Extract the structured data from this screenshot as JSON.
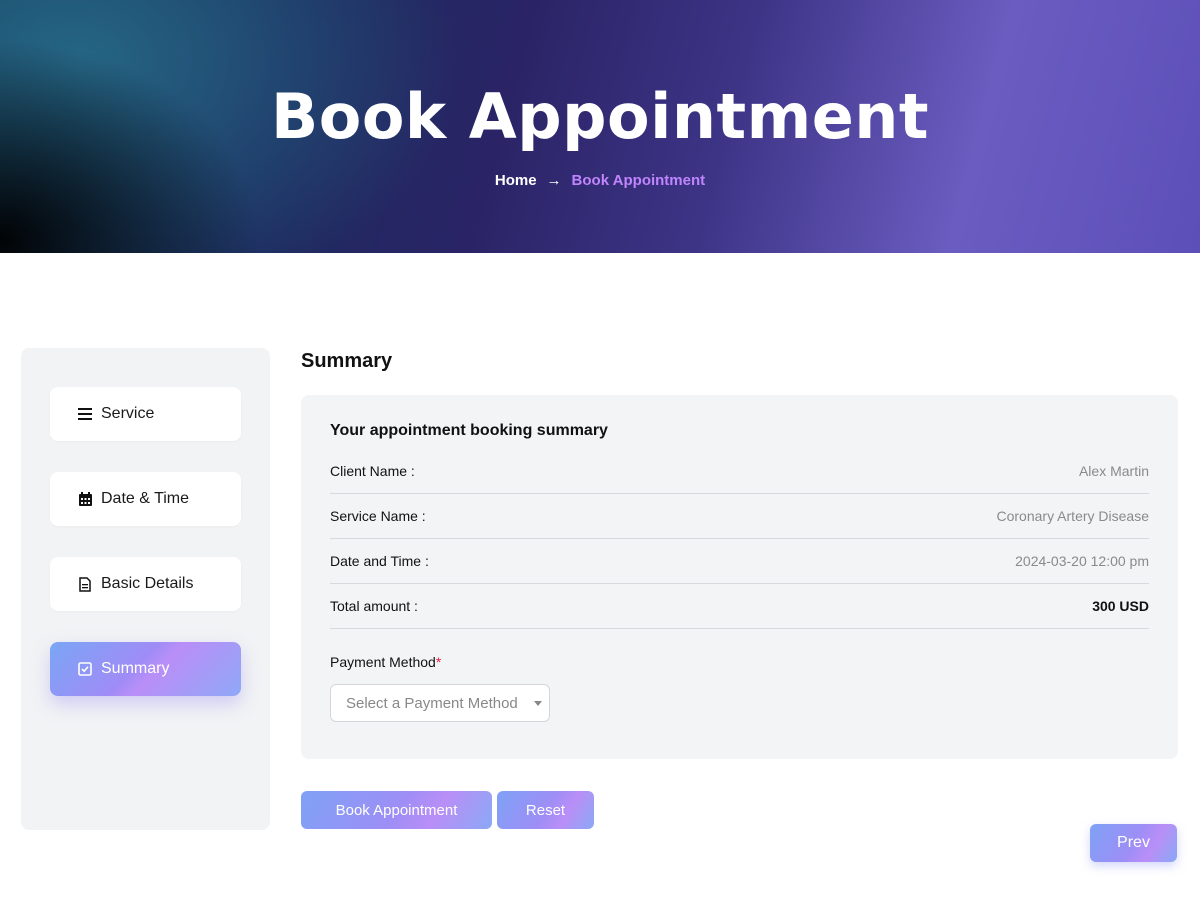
{
  "header": {
    "title": "Book Appointment",
    "breadcrumb": {
      "home": "Home",
      "separator": "→",
      "current": "Book Appointment"
    }
  },
  "sidebar": {
    "items": [
      {
        "label": "Service",
        "icon": "list-icon",
        "active": false
      },
      {
        "label": "Date & Time",
        "icon": "calendar-icon",
        "active": false
      },
      {
        "label": "Basic Details",
        "icon": "document-icon",
        "active": false
      },
      {
        "label": "Summary",
        "icon": "checkbox-icon",
        "active": true
      }
    ]
  },
  "main": {
    "section_title": "Summary",
    "card": {
      "heading": "Your appointment booking summary",
      "rows": [
        {
          "label": "Client Name :",
          "value": "Alex Martin"
        },
        {
          "label": "Service Name :",
          "value": "Coronary Artery Disease"
        },
        {
          "label": "Date and Time :",
          "value": "2024-03-20 12:00 pm"
        },
        {
          "label": "Total amount :",
          "value": "300 USD"
        }
      ],
      "payment": {
        "label": "Payment Method",
        "required_mark": "*",
        "placeholder": "Select a Payment Method"
      }
    },
    "buttons": {
      "book": "Book Appointment",
      "reset": "Reset",
      "prev": "Prev"
    }
  },
  "colors": {
    "accent_gradient_start": "#7fa2f5",
    "accent_gradient_mid": "#b98ef7",
    "breadcrumb_current": "#c084fc",
    "required": "#e11d48"
  }
}
